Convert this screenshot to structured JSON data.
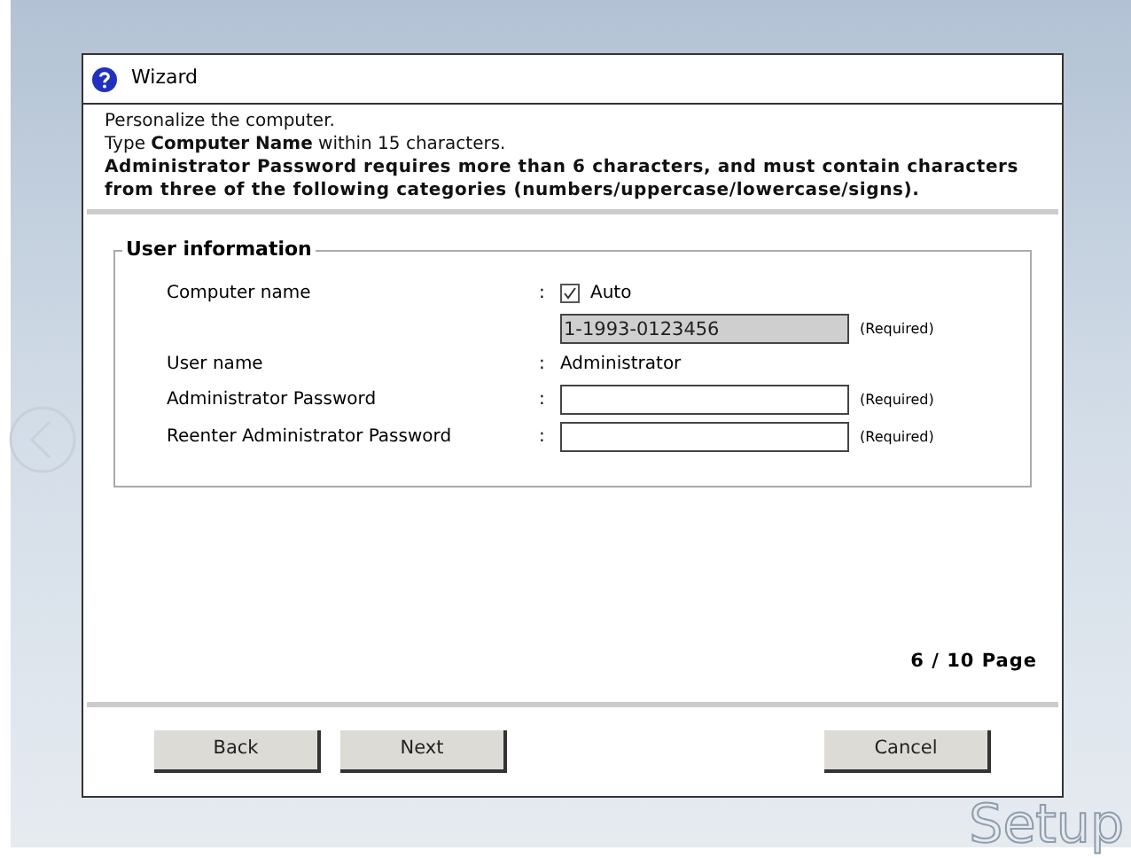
{
  "window": {
    "title": "Wizard"
  },
  "instructions": [
    "Personalize the computer.",
    "Type **Computer Name** within 15 characters.",
    "Administrator Password requires more than 6 characters, and must contain characters from three of the following categories (numbers/uppercase/lowercase/signs)."
  ],
  "group": {
    "title": "User information",
    "fields": [
      {
        "kind": "checkbox",
        "label": "Computer name",
        "separator": ":",
        "checkbox_label": "Auto",
        "checked": true
      },
      {
        "kind": "input",
        "value": "1-1993-0123456",
        "disabled": true,
        "note": "(Required)"
      },
      {
        "kind": "text",
        "label": "User name",
        "separator": ":",
        "value": "Administrator"
      },
      {
        "kind": "input",
        "label": "Administrator Password",
        "separator": ":",
        "disabled": false,
        "note": "(Required)"
      },
      {
        "kind": "input",
        "label": "Reenter Administrator Password",
        "separator": ":",
        "disabled": false,
        "note": "(Required)"
      }
    ]
  },
  "page_indicator": "6 / 10 Page",
  "buttons": [
    {
      "label": "Back"
    },
    {
      "label": "Next"
    },
    {
      "label": "Cancel"
    }
  ],
  "background_logo": "Setup"
}
